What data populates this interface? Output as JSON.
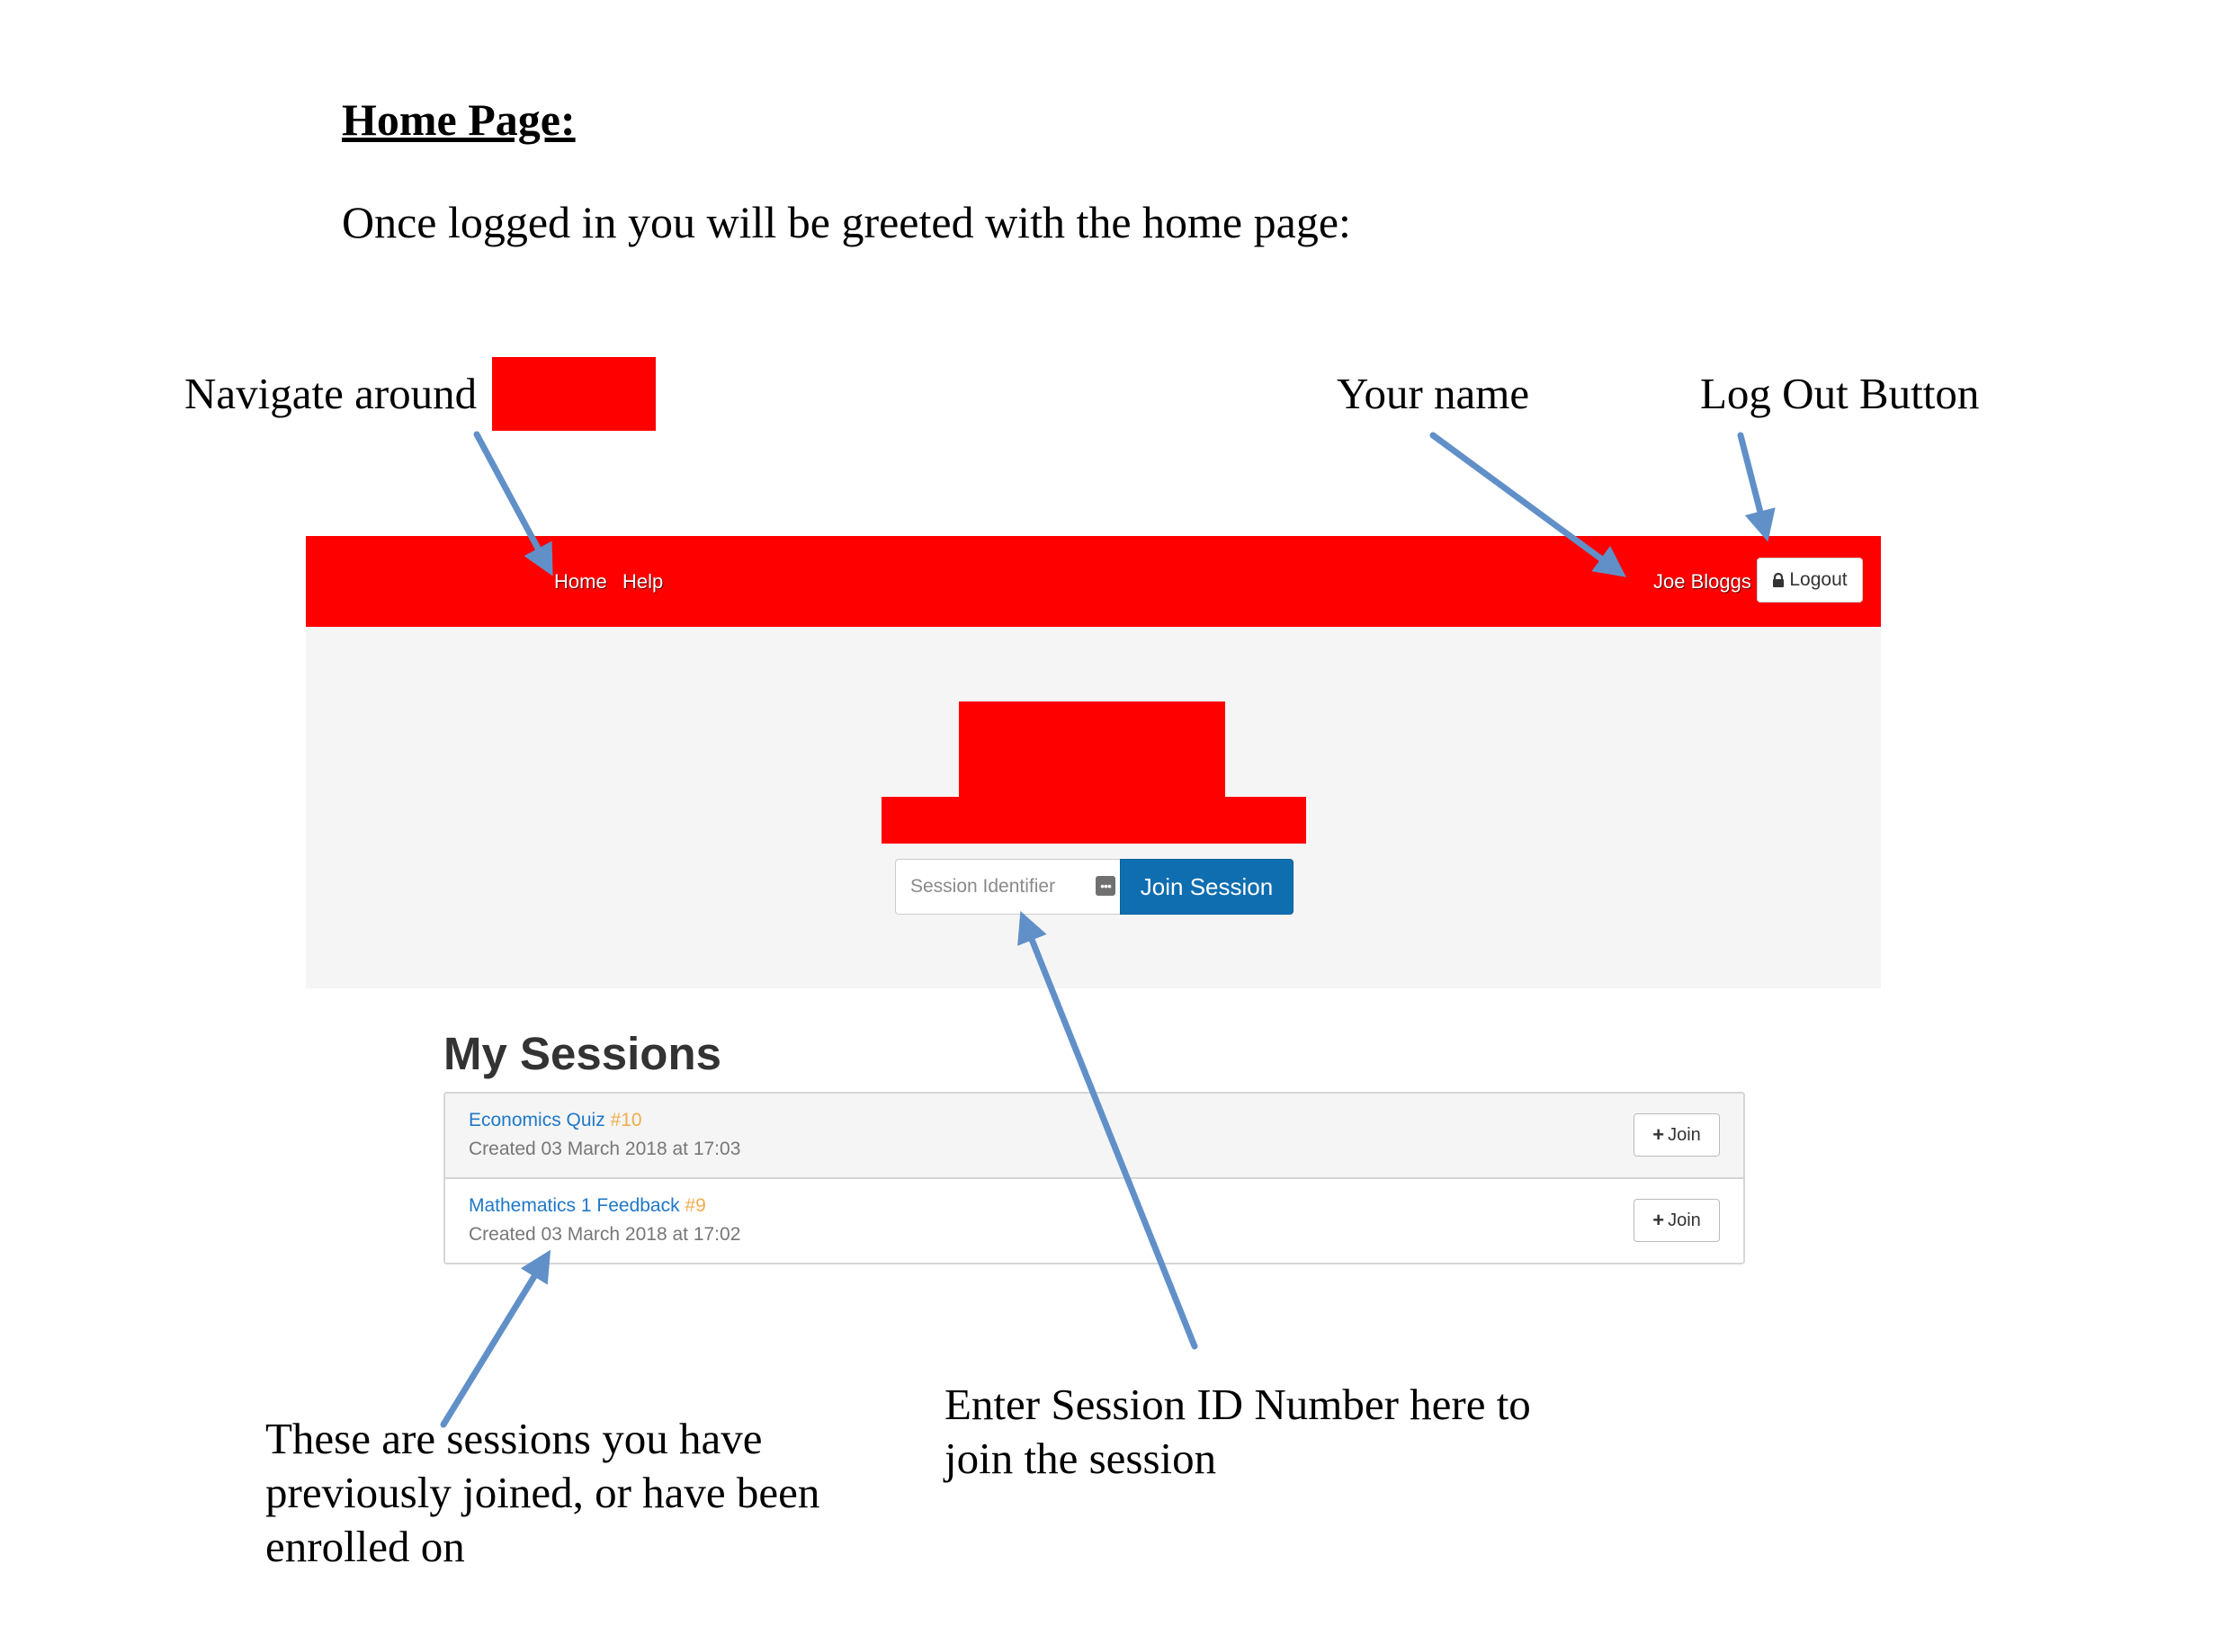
{
  "document": {
    "heading": "Home Page:",
    "intro": "Once logged in you will be greeted with the home page:"
  },
  "callouts": {
    "navigate": "Navigate around",
    "your_name": "Your name",
    "logout": "Log Out Button",
    "sessions_line1": "These are sessions you have",
    "sessions_line2": "previously joined, or have been",
    "sessions_line3": "enrolled on",
    "session_id_line1": "Enter Session ID Number here to",
    "session_id_line2": "join the session"
  },
  "navbar": {
    "links": [
      "Home",
      "Help"
    ],
    "user_name": "Joe Bloggs",
    "logout_label": "Logout",
    "logout_icon": "lock-icon"
  },
  "join_form": {
    "placeholder": "Session Identifier",
    "button_label": "Join Session",
    "input_icon": "more-dots-icon"
  },
  "sessions": {
    "title": "My Sessions",
    "items": [
      {
        "name": "Economics Quiz",
        "id": "#10",
        "created": "Created 03 March 2018 at 17:03",
        "button_label": "Join"
      },
      {
        "name": "Mathematics 1 Feedback",
        "id": "#9",
        "created": "Created 03 March 2018 at 17:02",
        "button_label": "Join"
      }
    ]
  },
  "colors": {
    "navbar": "#ff0000",
    "redaction": "#ff0000",
    "primary_button": "#0f6eb0",
    "link": "#1f78c8",
    "session_id": "#f0ad4e",
    "arrow": "#6190c8"
  }
}
